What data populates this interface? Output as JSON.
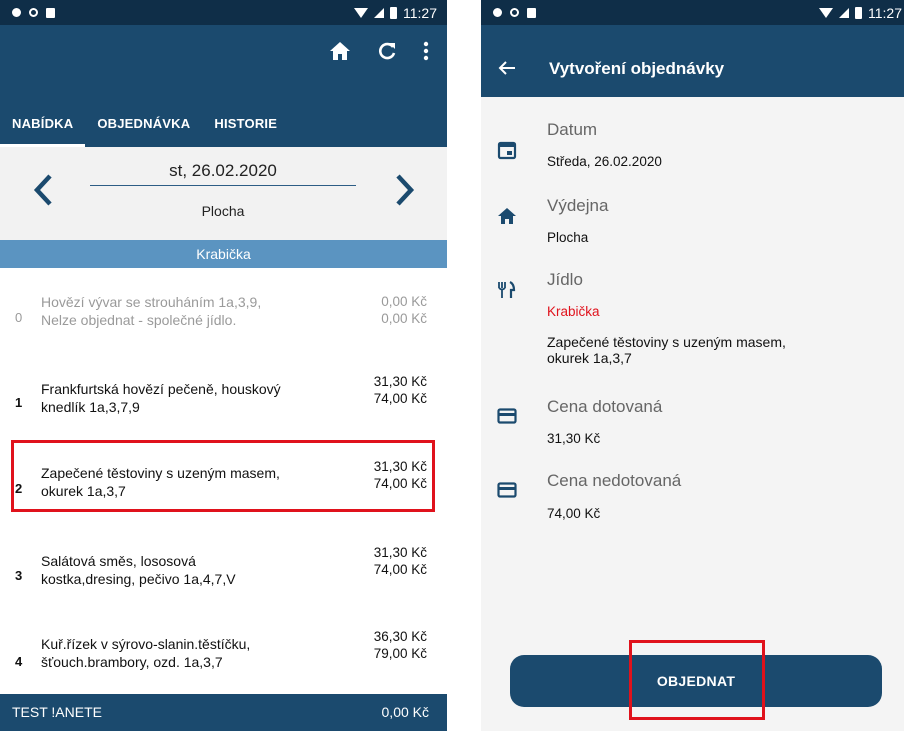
{
  "status_bar": {
    "time": "11:27"
  },
  "left": {
    "tabs": [
      {
        "label": "NABÍDKA",
        "active": true
      },
      {
        "label": "OBJEDNÁVKA",
        "active": false
      },
      {
        "label": "HISTORIE",
        "active": false
      }
    ],
    "toolbar_icons": [
      "home-icon",
      "refresh-icon",
      "more-vertical-icon"
    ],
    "date": "st, 26.02.2020",
    "place": "Plocha",
    "category": "Krabička",
    "menu": [
      {
        "num": "0",
        "name": "Hovězí vývar se strouháním  1a,3,9,",
        "name2": "Nelze objednat - společné jídlo.",
        "price1": "0,00 Kč",
        "price2": "0,00 Kč",
        "disabled": true
      },
      {
        "num": "1",
        "name": "Frankfurtská hovězí pečeně, houskový",
        "name2": "knedlík  1a,3,7,9",
        "price1": "31,30 Kč",
        "price2": "74,00 Kč",
        "disabled": false
      },
      {
        "num": "2",
        "name": "Zapečené těstoviny s uzeným masem,",
        "name2": "okurek  1a,3,7",
        "price1": "31,30 Kč",
        "price2": "74,00 Kč",
        "disabled": false
      },
      {
        "num": "3",
        "name": "Salátová směs, lososová",
        "name2": "kostka,dresing, pečivo  1a,4,7,V",
        "price1": "31,30 Kč",
        "price2": "74,00 Kč",
        "disabled": false
      },
      {
        "num": "4",
        "name": "Kuř.řízek v sýrovo-slanin.těstíčku,",
        "name2": "šťouch.brambory, ozd. 1a,3,7",
        "price1": "36,30 Kč",
        "price2": "79,00 Kč",
        "disabled": false
      }
    ],
    "bottom": {
      "user": "TEST !ANETE",
      "balance": "0,00 Kč"
    },
    "colors": {
      "appbar": "#1b4a6e",
      "category": "#5b94c1",
      "highlight": "#e0121c"
    }
  },
  "right": {
    "title": "Vytvoření objednávky",
    "fields": {
      "date": {
        "label": "Datum",
        "value": "Středa, 26.02.2020",
        "icon": "calendar-icon"
      },
      "canteen": {
        "label": "Výdejna",
        "value": "Plocha",
        "icon": "home-icon"
      },
      "meal": {
        "label": "Jídlo",
        "category": "Krabička",
        "desc1": "Zapečené těstoviny s uzeným masem,",
        "desc2": "okurek  1a,3,7",
        "icon": "cutlery-icon"
      },
      "price_sub": {
        "label": "Cena dotovaná",
        "value": "31,30 Kč",
        "icon": "card-icon"
      },
      "price_full": {
        "label": "Cena nedotovaná",
        "value": "74,00 Kč",
        "icon": "card-icon"
      }
    },
    "order_button": "OBJEDNAT"
  }
}
